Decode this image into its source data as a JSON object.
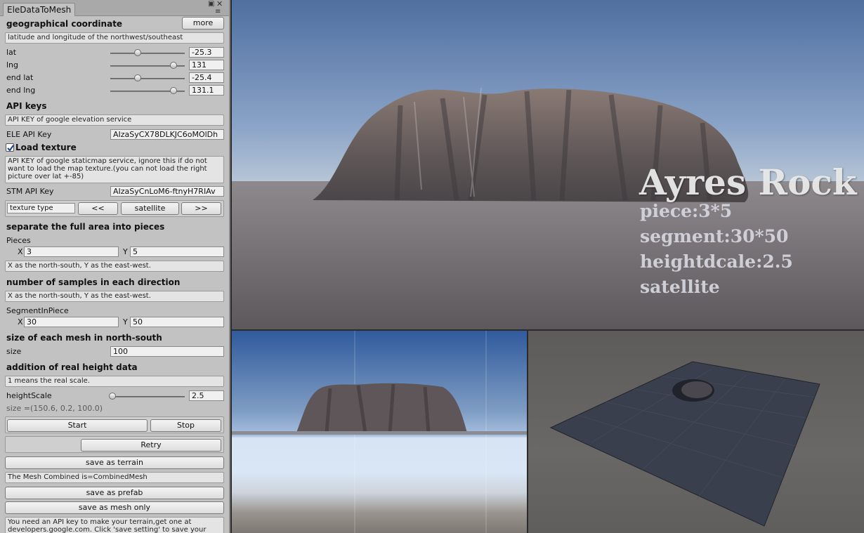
{
  "window": {
    "tab_title": "EleDataToMesh"
  },
  "sections": {
    "geo": {
      "heading": "geographical coordinate",
      "more_button": "more",
      "help": "latitude and longitude of the northwest/southeast",
      "rows": [
        {
          "label": "lat",
          "value": "-25.3",
          "level": 0.38
        },
        {
          "label": "lng",
          "value": "131",
          "level": 0.85
        },
        {
          "label": "end lat",
          "value": "-25.4",
          "level": 0.38
        },
        {
          "label": "end lng",
          "value": "131.1",
          "level": 0.85
        }
      ]
    },
    "api": {
      "heading": "API keys",
      "help": "API KEY of google elevation service",
      "ele_label": "ELE API Key",
      "ele_value": "AIzaSyCX78DLKJC6oMOlDh",
      "load_texture_label": "Load texture",
      "load_texture_checked": true,
      "stm_help": "API KEY of google staticmap service, ignore this if do not want to load the map texture.(you can not load the right picture over lat +-85)",
      "stm_label": "STM API Key",
      "stm_value": "AIzaSyCnLoM6-ftnyH7RIAv",
      "texture_type_label": "texture type",
      "prev_button": "<<",
      "texture_value": "satellite",
      "next_button": ">>"
    },
    "pieces": {
      "heading": "separate the full area into pieces",
      "label": "Pieces",
      "x_label": "X",
      "x_value": "3",
      "y_label": "Y",
      "y_value": "5",
      "help": "X as the north-south, Y as the east-west."
    },
    "samples": {
      "heading": "number of samples in each direction",
      "help": "X as the north-south, Y as the east-west.",
      "label": "SegmentInPiece",
      "x_label": "X",
      "x_value": "30",
      "y_label": "Y",
      "y_value": "50"
    },
    "size": {
      "heading": "size of each mesh in north-south",
      "label": "size",
      "value": "100"
    },
    "height": {
      "heading": "addition of real height data",
      "help": "1 means the real scale.",
      "label": "heightScale",
      "value": "2.5",
      "level": 0.02,
      "size_readout": "size =(150.6, 0.2, 100.0)"
    },
    "actions": {
      "start": "Start",
      "stop": "Stop",
      "retry": "Retry",
      "save_terrain": "save as terrain",
      "combined_info": "The Mesh Combined is=CombinedMesh",
      "save_prefab": "save as prefab",
      "save_mesh": "save as mesh only",
      "footer_help": "You need an API key to make your terrain,get one at developers.google.com. Click 'save setting' to save your"
    }
  },
  "overlay": {
    "title": "Ayres Rock",
    "lines": [
      "piece:3*5",
      "segment:30*50",
      "heightdcale:2.5",
      "satellite"
    ]
  }
}
